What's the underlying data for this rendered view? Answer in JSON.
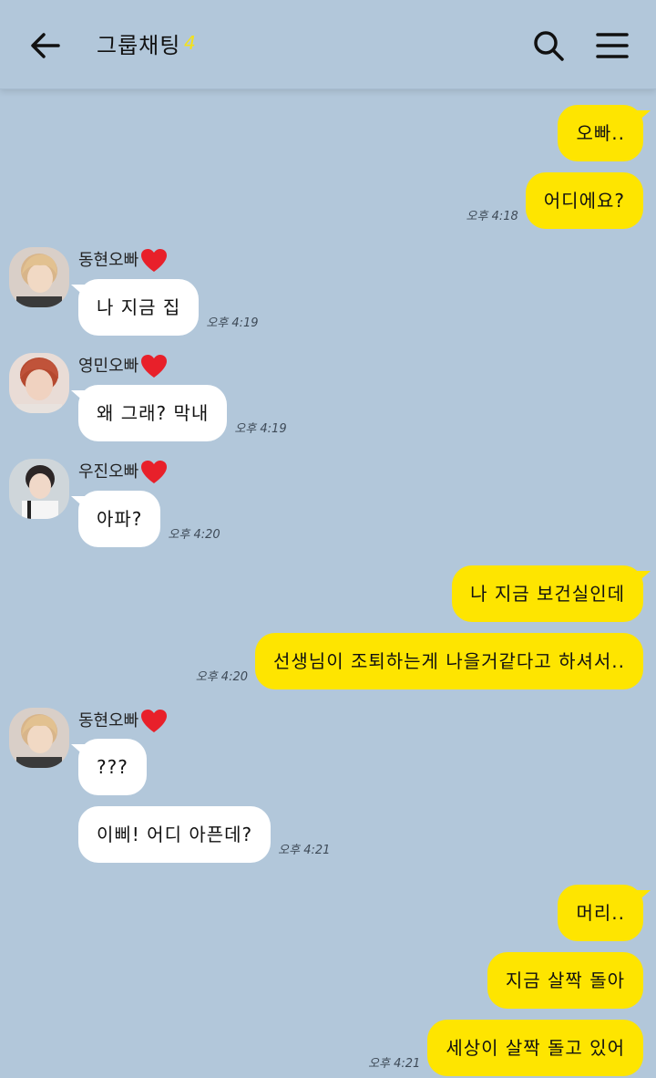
{
  "header": {
    "title": "그룹채팅",
    "member_count": "4"
  },
  "colors": {
    "background": "#b2c7da",
    "my_bubble": "#fee500",
    "other_bubble": "#ffffff",
    "member_count": "#f5e216",
    "heart": "#e8202a"
  },
  "senders": {
    "donghyun": {
      "name": "동현오빠",
      "badge_icon": "heart-icon"
    },
    "youngmin": {
      "name": "영민오빠",
      "badge_icon": "heart-icon"
    },
    "woojin": {
      "name": "우진오빠",
      "badge_icon": "heart-icon"
    }
  },
  "messages": [
    {
      "from": "me",
      "text": "오빠..",
      "time": ""
    },
    {
      "from": "me",
      "text": "어디에요?",
      "time": "오후 4:18"
    },
    {
      "from": "donghyun",
      "text": "나 지금 집",
      "time": "오후 4:19"
    },
    {
      "from": "youngmin",
      "text": "왜 그래? 막내",
      "time": "오후 4:19"
    },
    {
      "from": "woojin",
      "text": "아파?",
      "time": "오후 4:20"
    },
    {
      "from": "me",
      "text": "나 지금 보건실인데",
      "time": ""
    },
    {
      "from": "me",
      "text": "선생님이 조퇴하는게 나을거같다고 하셔서..",
      "time": "오후 4:20"
    },
    {
      "from": "donghyun",
      "text": "???",
      "time": ""
    },
    {
      "from": "donghyun",
      "text": "이삐! 어디 아픈데?",
      "time": "오후 4:21"
    },
    {
      "from": "me",
      "text": "머리..",
      "time": ""
    },
    {
      "from": "me",
      "text": "지금 살짝 돌아",
      "time": ""
    },
    {
      "from": "me",
      "text": "세상이 살짝 돌고 있어",
      "time": "오후 4:21"
    }
  ]
}
